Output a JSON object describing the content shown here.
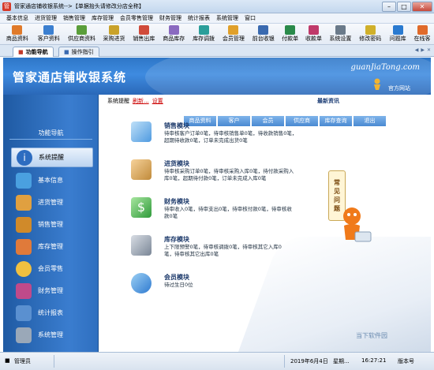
{
  "titlebar": {
    "title": "管家通店铺收银系统-->【单据抬头请修改分店全称】",
    "minimize": "–",
    "maximize": "□",
    "close": "✕"
  },
  "menu": [
    "基本信息",
    "进货管理",
    "销售管理",
    "库存管理",
    "会员零售管理",
    "财务管理",
    "统计报表",
    "系统管理",
    "窗口"
  ],
  "toolbar": [
    "商品资料",
    "客户资料",
    "供应商资料",
    "采购进货",
    "销售出库",
    "商品库存",
    "库存调拨",
    "会员管理",
    "前台收银",
    "付款单",
    "收款单",
    "系统设置",
    "修改密码",
    "问题库",
    "在线客"
  ],
  "tabs": {
    "active": "功能导航",
    "inactive": "操作指引"
  },
  "header": {
    "title": "管家通店铺收银系统",
    "url": "guanJiaTong.com",
    "site_link": "官方网站"
  },
  "sidebar": {
    "title": "功能导航",
    "items": [
      {
        "label": "系统提醒",
        "icon": "info-icon"
      },
      {
        "label": "基本信息",
        "icon": "boxes-icon"
      },
      {
        "label": "进货管理",
        "icon": "package-icon"
      },
      {
        "label": "销售管理",
        "icon": "cart-icon"
      },
      {
        "label": "库存管理",
        "icon": "warehouse-icon"
      },
      {
        "label": "会员零售",
        "icon": "members-icon"
      },
      {
        "label": "财务管理",
        "icon": "money-icon"
      },
      {
        "label": "统计报表",
        "icon": "report-icon"
      },
      {
        "label": "系统管理",
        "icon": "gears-icon"
      }
    ]
  },
  "content": {
    "crumb_label": "系统提醒",
    "crumb_refresh": "刷新...",
    "crumb_settings": "设置",
    "latest": "最新资讯",
    "quickbar": [
      "商品资料",
      "客户",
      "会员",
      "供应商",
      "库存查询",
      "退出"
    ],
    "modules": [
      {
        "title": "销售模块",
        "lines": [
          "待审核客户订单0笔，待审核销售单0笔，待收款销售0笔，",
          "超期待收款0笔，订单未完成出货0笔"
        ]
      },
      {
        "title": "进货模块",
        "lines": [
          "待审核采购订单0笔，待审核采购入库0笔，待付款采购入",
          "库0笔，超期待付款0笔，订单未完成入库0笔"
        ]
      },
      {
        "title": "财务模块",
        "lines": [
          "待审收入0笔，待审支出0笔，待审核付款0笔，待审核收",
          "款0笔"
        ]
      },
      {
        "title": "库存模块",
        "lines": [
          "上下限预警0笔，待审核调拨0笔，待审核其它入库0",
          "笔，待审核其它出库0笔"
        ]
      },
      {
        "title": "会员模块",
        "lines": [
          "待过生日0位"
        ]
      }
    ],
    "faq": [
      "常",
      "见",
      "问",
      "题"
    ],
    "watermark": "当下软件园"
  },
  "status": {
    "user": "管理员",
    "date": "2019年6月4日",
    "weekday": "星期...",
    "time": "16:27:21",
    "version": "版本号"
  }
}
